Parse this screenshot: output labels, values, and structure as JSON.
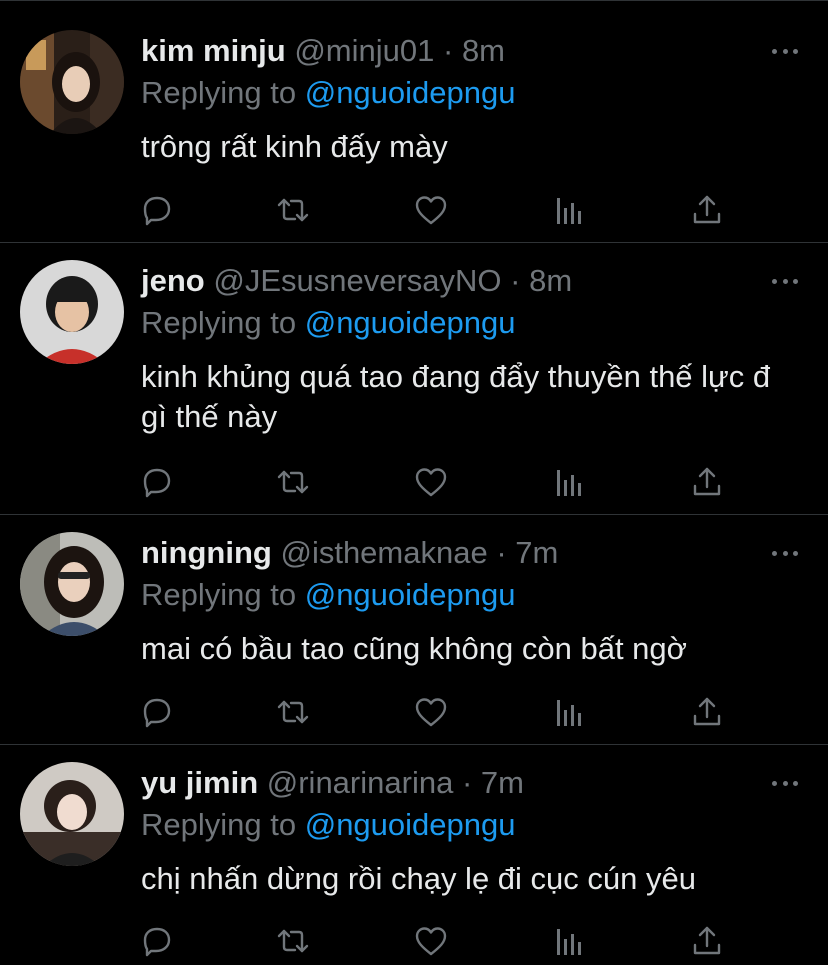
{
  "colors": {
    "background": "#000000",
    "primary_text": "#e7e9ea",
    "secondary_text": "#71767b",
    "mention": "#1d9bf0",
    "divider": "#2f3336"
  },
  "labels": {
    "replying_prefix": "Replying to",
    "separator": "·"
  },
  "tweets": [
    {
      "name": "kim minju",
      "handle": "@minju01",
      "time": "8m",
      "reply_to": "@nguoidepngu",
      "text": "trông rất kinh đấy mày",
      "avatar_icon": "avatar-kim-minju"
    },
    {
      "name": "jeno",
      "handle": "@JEsusneversayNO",
      "time": "8m",
      "reply_to": "@nguoidepngu",
      "text": "kinh khủng quá tao đang đẩy thuyền thế lực đ gì thế này",
      "avatar_icon": "avatar-jeno"
    },
    {
      "name": "ningning",
      "handle": "@isthemaknae",
      "time": "7m",
      "reply_to": "@nguoidepngu",
      "text": "mai có bầu tao cũng không còn bất ngờ",
      "avatar_icon": "avatar-ningning"
    },
    {
      "name": "yu jimin",
      "handle": "@rinarinarina",
      "time": "7m",
      "reply_to": "@nguoidepngu",
      "text": "chị nhấn dừng rồi chạy lẹ đi cục cún yêu",
      "avatar_icon": "avatar-yu-jimin"
    }
  ],
  "action_icons": [
    "reply-icon",
    "retweet-icon",
    "like-icon",
    "analytics-icon",
    "share-icon"
  ]
}
